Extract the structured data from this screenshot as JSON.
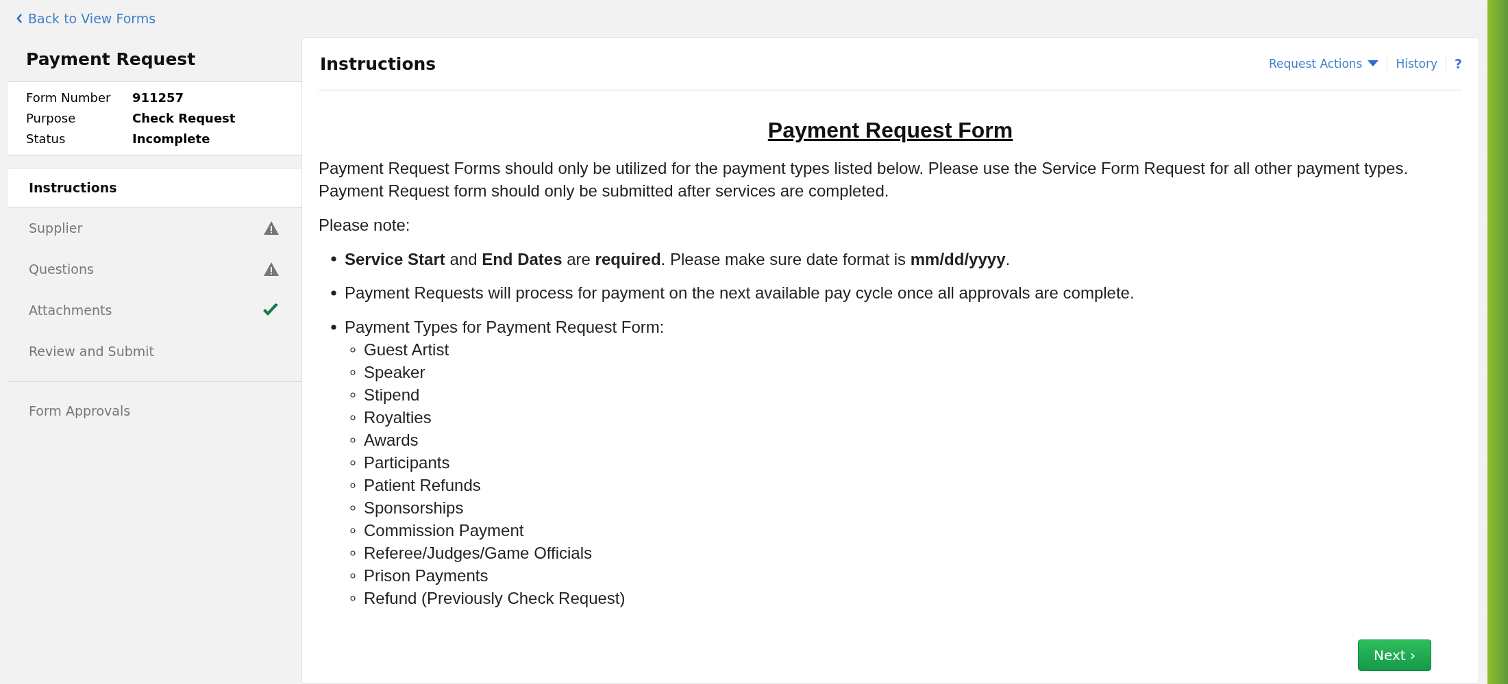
{
  "back_link": {
    "label": "Back to View Forms"
  },
  "sidebar": {
    "title": "Payment Request",
    "info": [
      {
        "label": "Form Number",
        "value": "911257"
      },
      {
        "label": "Purpose",
        "value": "Check Request"
      },
      {
        "label": "Status",
        "value": "Incomplete"
      }
    ],
    "items": [
      {
        "label": "Instructions",
        "selected": true
      },
      {
        "label": "Supplier",
        "selected": false,
        "kind": "warning"
      },
      {
        "label": "Questions",
        "selected": false,
        "kind": "warning"
      },
      {
        "label": "Attachments",
        "selected": false,
        "kind": "complete"
      },
      {
        "label": "Review and Submit",
        "selected": false
      }
    ],
    "extra_items": [
      {
        "label": "Form Approvals",
        "selected": false
      }
    ]
  },
  "main": {
    "header": "Instructions",
    "actions": [
      {
        "label": "Request Actions",
        "kind": "dropdown"
      },
      {
        "label": "History",
        "kind": "link"
      },
      {
        "label": "?",
        "kind": "help"
      }
    ],
    "title": "Payment Request Form",
    "intro": "Payment Request Forms should only be utilized for the payment types listed below.  Please use the Service Form Request for all other payment types. Payment Request form should only be submitted after services are completed.",
    "note": "Please note:",
    "bullets": [
      {
        "text": "**Service Start** and **End Dates** are **required**. Please make sure date format is **mm/dd/yyyy**."
      },
      {
        "text": "Payment Requests will process for payment on the next available pay cycle once all approvals are complete."
      },
      {
        "text": "Payment Types for Payment Request Form:",
        "children": [
          {
            "text": "Guest Artist"
          },
          {
            "text": "Speaker"
          },
          {
            "text": "Stipend"
          },
          {
            "text": "Royalties"
          },
          {
            "text": "Awards"
          },
          {
            "text": "Participants"
          },
          {
            "text": "Patient Refunds"
          },
          {
            "text": "Sponsorships"
          },
          {
            "text": "Commission Payment"
          },
          {
            "text": "Referee/Judges/Game Officials"
          },
          {
            "text": "Prison Payments"
          },
          {
            "text": "Refund (Previously Check Request)"
          }
        ]
      }
    ],
    "next_button": "Next ›"
  }
}
